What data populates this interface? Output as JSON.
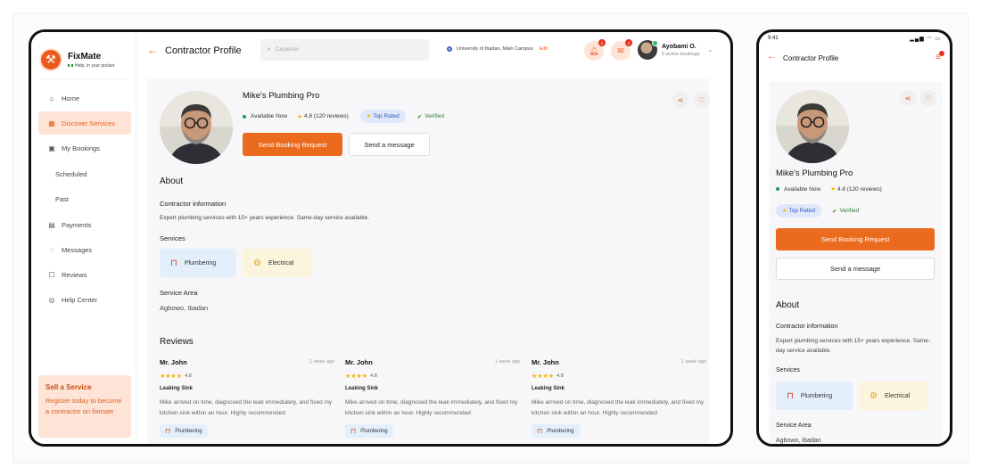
{
  "colors": {
    "accent": "#ea6a1e",
    "accent_soft": "#fde4d6",
    "success": "#16a34a",
    "badge_blue": "#dfe7fb"
  },
  "app": {
    "name": "FixMate",
    "tagline": "Help, in your pocket"
  },
  "sidebar": {
    "items": [
      {
        "label": "Home",
        "icon": "home-icon",
        "glyph": "⌂"
      },
      {
        "label": "Discover Services",
        "icon": "storefront-icon",
        "glyph": "▦"
      },
      {
        "label": "My Bookings",
        "icon": "calendar-icon",
        "glyph": "▣"
      }
    ],
    "subitems": [
      {
        "label": "Scheduled"
      },
      {
        "label": "Past"
      }
    ],
    "items2": [
      {
        "label": "Payments",
        "icon": "wallet-icon",
        "glyph": "▤"
      },
      {
        "label": "Messages",
        "icon": "chat-icon",
        "glyph": "◌"
      },
      {
        "label": "Reviews",
        "icon": "review-icon",
        "glyph": "☐"
      },
      {
        "label": "Help Center",
        "icon": "help-icon",
        "glyph": "◎"
      }
    ],
    "promo": {
      "title": "Sell a Service",
      "text": "Register today to become a contractor on fixmate"
    }
  },
  "header": {
    "title": "Contractor Profile",
    "search_placeholder": "Carpenter",
    "location": "University of Ibadan, Main Campus",
    "location_edit": "Edit",
    "notifications_count": "2",
    "messages_count": "3",
    "user_name": "Ayobami O.",
    "user_sub": "0 active bookings"
  },
  "profile": {
    "name": "Mike's Plumbing Pro",
    "availability": "Available Now",
    "rating": "4.8 (120 reviews)",
    "badge_top": "Top Rated",
    "badge_verified": "Verified",
    "book_label": "Send Booking Request",
    "message_label": "Send a message"
  },
  "about": {
    "heading": "About",
    "info_heading": "Contractor information",
    "info_text": "Expert plumbing services with 15+ years experience. Same-day service available.",
    "services_heading": "Services",
    "services": [
      {
        "label": "Plumbering"
      },
      {
        "label": "Electrical"
      }
    ],
    "area_heading": "Service Area",
    "area": "Agbowo, Ibadan"
  },
  "reviews": {
    "heading": "Reviews",
    "items": [
      {
        "name": "Mr. John",
        "time": "1 week ago",
        "stars": "★★★★",
        "score": "4.8",
        "title": "Leaking Sink",
        "text": "Mike arrived on time, diagnosed the leak immediately, and fixed my kitchen sink within an hour. Highly recommended",
        "tag": "Plumbering"
      },
      {
        "name": "Mr. John",
        "time": "1 week ago",
        "stars": "★★★★",
        "score": "4.8",
        "title": "Leaking Sink",
        "text": "Mike arrived on time, diagnosed the leak immediately, and fixed my kitchen sink within an hour. Highly recommended",
        "tag": "Plumbering"
      },
      {
        "name": "Mr. John",
        "time": "1 week ago",
        "stars": "★★★★",
        "score": "4.8",
        "title": "Leaking Sink",
        "text": "Mike arrived on time, diagnosed the leak immediately, and fixed my kitchen sink within an hour. Highly recommended",
        "tag": "Plumbering"
      }
    ]
  },
  "mobile": {
    "time": "9:41",
    "signal": "▂▄▆ ◠ ▭",
    "title": "Contractor Profile",
    "info_text": "Expert plumbing services with 15+ years experience. Same-day service available."
  }
}
